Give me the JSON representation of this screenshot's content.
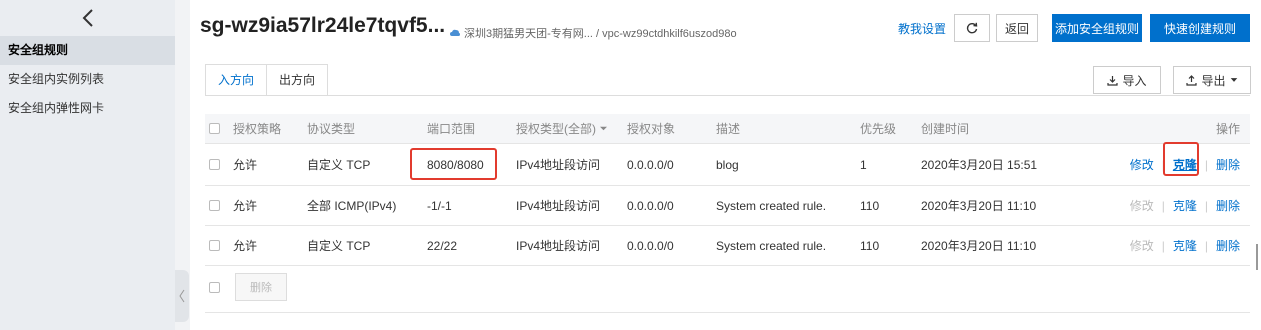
{
  "sidebar": {
    "items": [
      {
        "label": "安全组规则",
        "active": true
      },
      {
        "label": "安全组内实例列表",
        "active": false
      },
      {
        "label": "安全组内弹性网卡",
        "active": false
      }
    ]
  },
  "header": {
    "title": "sg-wz9ia57lr24le7tqvf5...",
    "breadcrumb": "深圳3期猛男天团-专有网... / vpc-wz99ctdhkilf6uszod98o",
    "tutorial_label": "教我设置",
    "back_label": "返回",
    "add_rule_label": "添加安全组规则",
    "quick_create_label": "快速创建规则"
  },
  "tabs": [
    {
      "label": "入方向",
      "active": true
    },
    {
      "label": "出方向",
      "active": false
    }
  ],
  "actions": {
    "import_label": "导入",
    "export_label": "导出"
  },
  "table": {
    "columns": [
      "授权策略",
      "协议类型",
      "端口范围",
      "授权类型(全部)",
      "授权对象",
      "描述",
      "优先级",
      "创建时间",
      "操作"
    ],
    "rows": [
      {
        "policy": "允许",
        "protocol": "自定义 TCP",
        "port": "8080/8080",
        "auth_type": "IPv4地址段访问",
        "target": "0.0.0.0/0",
        "desc": "blog",
        "priority": "1",
        "created": "2020年3月20日 15:51",
        "edit": "修改",
        "clone": "克隆",
        "delete": "删除",
        "edit_enabled": true
      },
      {
        "policy": "允许",
        "protocol": "全部 ICMP(IPv4)",
        "port": "-1/-1",
        "auth_type": "IPv4地址段访问",
        "target": "0.0.0.0/0",
        "desc": "System created rule.",
        "priority": "110",
        "created": "2020年3月20日 11:10",
        "edit": "修改",
        "clone": "克隆",
        "delete": "删除",
        "edit_enabled": false
      },
      {
        "policy": "允许",
        "protocol": "自定义 TCP",
        "port": "22/22",
        "auth_type": "IPv4地址段访问",
        "target": "0.0.0.0/0",
        "desc": "System created rule.",
        "priority": "110",
        "created": "2020年3月20日 11:10",
        "edit": "修改",
        "clone": "克隆",
        "delete": "删除",
        "edit_enabled": false
      }
    ],
    "bulk_delete_label": "删除"
  },
  "colors": {
    "primary": "#0070cc",
    "highlight": "#e23b2e"
  }
}
